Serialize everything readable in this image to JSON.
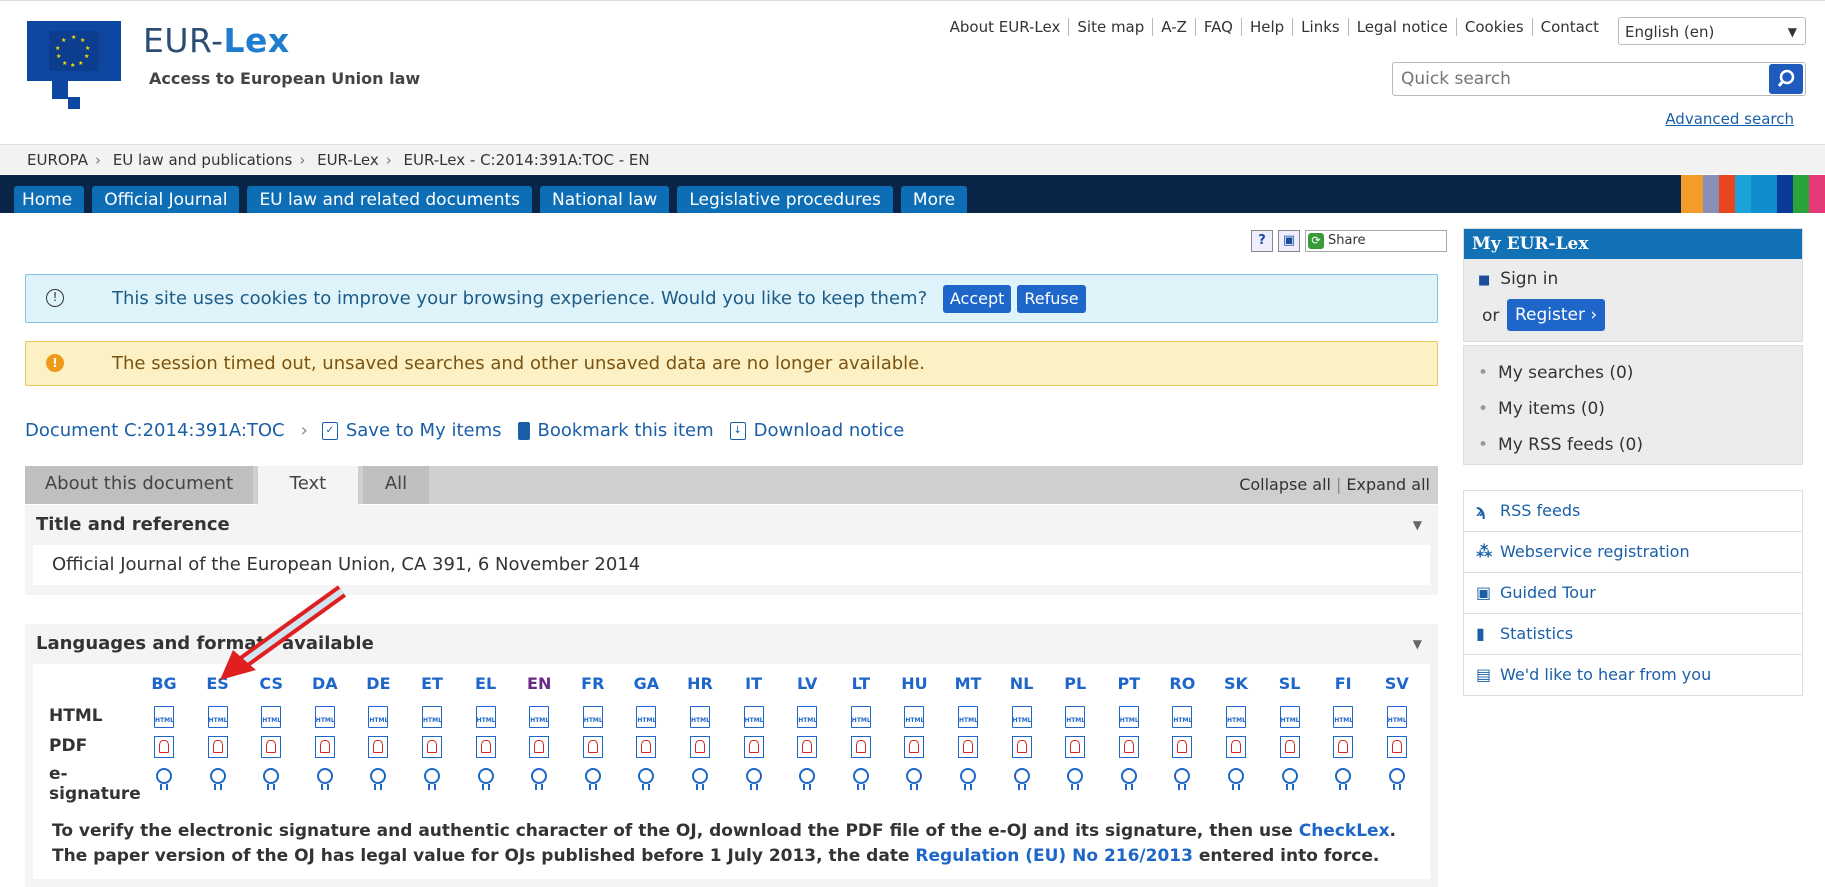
{
  "header": {
    "brand_prefix": "EUR-",
    "brand_main": "Lex",
    "tagline": "Access to European Union law",
    "top_links": [
      "About EUR-Lex",
      "Site map",
      "A-Z",
      "FAQ",
      "Help",
      "Links",
      "Legal notice",
      "Cookies",
      "Contact"
    ],
    "language": "English (en)",
    "search_placeholder": "Quick search",
    "advanced_search": "Advanced search"
  },
  "breadcrumb": [
    "EUROPA",
    "EU law and publications",
    "EUR-Lex",
    "EUR-Lex - C:2014:391A:TOC - EN"
  ],
  "nav": {
    "tabs": [
      "Home",
      "Official Journal",
      "EU law and related documents",
      "National law",
      "Legislative procedures",
      "More"
    ],
    "stripe_colors": [
      "#f39c2a",
      "#8a8fb8",
      "#e84520",
      "#1aa2d9",
      "#0e8ecd",
      "#0a3a98",
      "#2aa33a",
      "#e6397a"
    ]
  },
  "tools": {
    "help": "?",
    "print": "▣",
    "share": "Share"
  },
  "cookie_notice": {
    "text": "This site uses cookies to improve your browsing experience. Would you like to keep them?",
    "accept": "Accept",
    "refuse": "Refuse"
  },
  "session_notice": "The session timed out, unsaved searches and other unsaved data are no longer available.",
  "doc_actions": {
    "document": "Document C:2014:391A:TOC",
    "save": "Save to My items",
    "bookmark": "Bookmark this item",
    "download": "Download notice"
  },
  "doc_tabs": {
    "about": "About this document",
    "text": "Text",
    "all": "All",
    "collapse": "Collapse all",
    "expand": "Expand all"
  },
  "title_panel": {
    "heading": "Title and reference",
    "body": "Official Journal of the European Union, CA 391, 6 November 2014"
  },
  "languages_panel": {
    "heading": "Languages and formats available",
    "row_html": "HTML",
    "row_pdf": "PDF",
    "row_esig_1": "e-",
    "row_esig_2": "signature",
    "languages": [
      "BG",
      "ES",
      "CS",
      "DA",
      "DE",
      "ET",
      "EL",
      "EN",
      "FR",
      "GA",
      "HR",
      "IT",
      "LV",
      "LT",
      "HU",
      "MT",
      "NL",
      "PL",
      "PT",
      "RO",
      "SK",
      "SL",
      "FI",
      "SV"
    ],
    "html_icon_text": "HTML",
    "verify_1": "To verify the electronic signature and authentic character of the OJ, download the PDF file of the e-OJ and its signature, then use ",
    "checklex": "CheckLex",
    "verify_2": ". The paper version of the OJ has legal value for OJs published before 1 July 2013, the date ",
    "regulation": "Regulation (EU) No 216/2013",
    "verify_3": " entered into force."
  },
  "my_eurlex": {
    "heading": "My EUR-Lex",
    "sign_in": "Sign in",
    "or": "or",
    "register": "Register ›",
    "items": [
      "My searches (0)",
      "My items (0)",
      "My RSS feeds (0)"
    ]
  },
  "side_links": [
    {
      "icon": "rss-icon",
      "glyph": "ϡ",
      "label": "RSS feeds"
    },
    {
      "icon": "webservice-icon",
      "glyph": "⁂",
      "label": "Webservice registration"
    },
    {
      "icon": "guided-tour-icon",
      "glyph": "▣",
      "label": "Guided Tour"
    },
    {
      "icon": "statistics-icon",
      "glyph": "▮",
      "label": "Statistics"
    },
    {
      "icon": "feedback-icon",
      "glyph": "▤",
      "label": "We'd like to hear from you"
    }
  ],
  "colors": {
    "accent": "#1e66c9",
    "nav_bg": "#0a2548",
    "tab_bg": "#0d6eb5",
    "annotation_arrow": "#e02020"
  }
}
